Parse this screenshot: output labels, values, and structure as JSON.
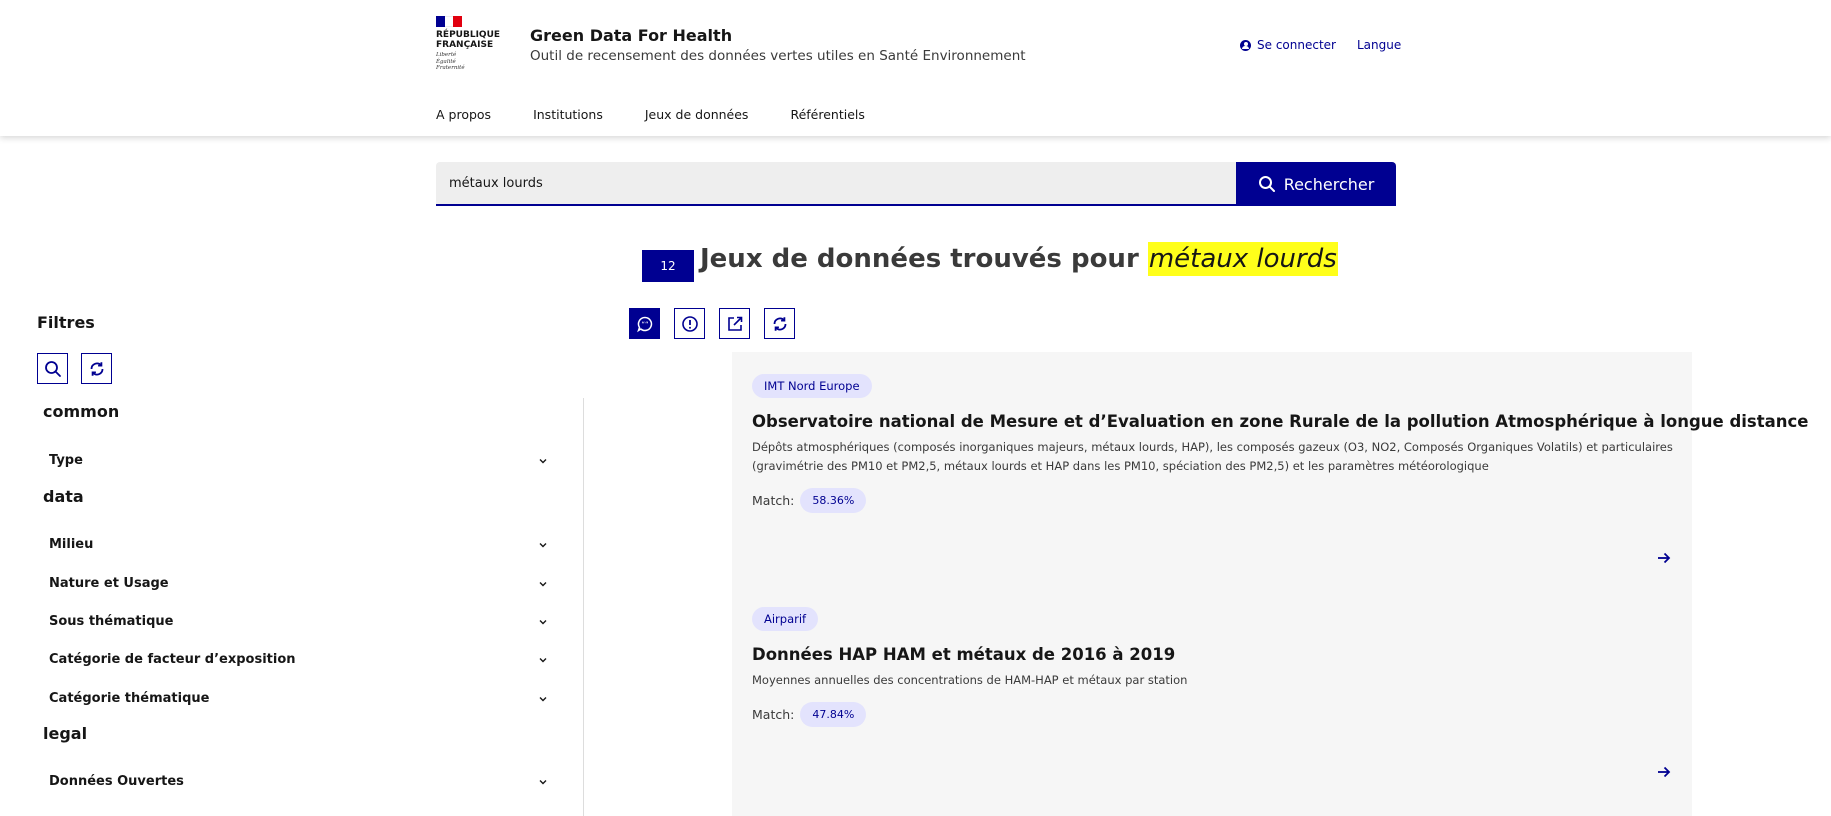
{
  "header": {
    "logo_lines": [
      "RÉPUBLIQUE",
      "FRANÇAISE"
    ],
    "logo_motto": [
      "Liberté",
      "Égalité",
      "Fraternité"
    ],
    "service_title": "Green Data For Health",
    "service_tagline": "Outil de recensement des données vertes utiles en Santé Environnement",
    "login_label": "Se connecter",
    "language_label": "Langue",
    "nav": [
      "A propos",
      "Institutions",
      "Jeux de données",
      "Référentiels"
    ],
    "flag_colors": [
      "#000091",
      "#ffffff",
      "#e1000f"
    ]
  },
  "search": {
    "value": "métaux lourds",
    "button_label": "Rechercher"
  },
  "results": {
    "count": "12",
    "heading_text": "Jeux de données trouvés pour",
    "query": "métaux lourds"
  },
  "filters": {
    "title": "Filtres",
    "groups": [
      {
        "title": "common",
        "facets": [
          "Type"
        ]
      },
      {
        "title": "data",
        "facets": [
          "Milieu",
          "Nature et Usage",
          "Sous thématique",
          "Catégorie de facteur d’exposition",
          "Catégorie thématique"
        ]
      },
      {
        "title": "legal",
        "facets": [
          "Données Ouvertes"
        ]
      }
    ]
  },
  "cards": [
    {
      "tag": "IMT Nord Europe",
      "title": "Observatoire national de Mesure et d’Evaluation en zone Rurale de la pollution Atmosphérique à longue distance",
      "description": "Dépôts atmosphériques (composés inorganiques majeurs, métaux lourds, HAP), les composés gazeux (O3, NO2, Composés Organiques Volatils) et particulaires (gravimétrie des PM10 et PM2,5, métaux lourds et HAP dans les PM10, spéciation des PM2,5) et les paramètres météorologique",
      "match_label": "Match:",
      "match_value": "58.36%"
    },
    {
      "tag": "Airparif",
      "title": "Données HAP HAM et métaux de 2016 à 2019",
      "description": "Moyennes annuelles des concentrations de HAM-HAP et métaux par station",
      "match_label": "Match:",
      "match_value": "47.84%"
    }
  ],
  "colors": {
    "primary": "#000091",
    "highlight": "#ffff1a",
    "tag_bg": "#e3e3fd",
    "panel_bg": "#f6f6f6"
  }
}
